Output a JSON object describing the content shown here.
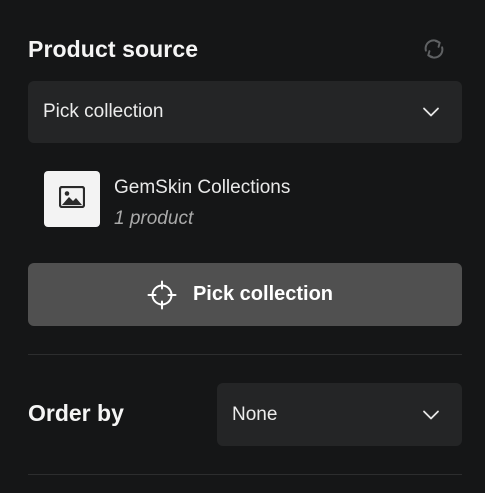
{
  "product_source": {
    "title": "Product source",
    "sync_icon": "sync-icon",
    "collection_select": {
      "value": "Pick collection",
      "icon": "chevron-down-icon"
    },
    "selected_collection": {
      "name": "GemSkin Collections",
      "count": "1 product",
      "thumbnail_icon": "image-placeholder-icon"
    },
    "pick_button": {
      "label": "Pick collection",
      "icon": "crosshair-icon"
    }
  },
  "order_by": {
    "label": "Order by",
    "select": {
      "value": "None",
      "icon": "chevron-down-icon"
    }
  },
  "colors": {
    "background": "#151617",
    "field": "#242526",
    "button": "#505050",
    "divider": "#2c2d2e"
  }
}
